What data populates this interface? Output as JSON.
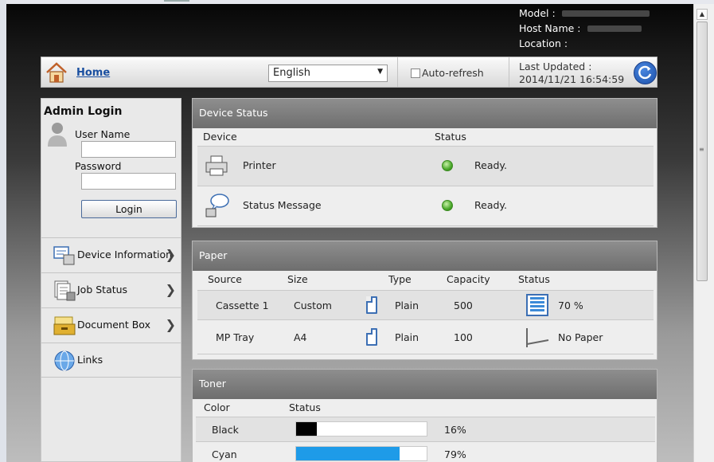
{
  "header": {
    "model_label": "Model :",
    "host_label": "Host Name :",
    "location_label": "Location :"
  },
  "nav": {
    "home": "Home",
    "language": "English",
    "autorefresh": "Auto-refresh",
    "last_updated_label": "Last Updated :",
    "last_updated_value": "2014/11/21 16:54:59"
  },
  "sidebar": {
    "admin_title": "Admin Login",
    "username_label": "User Name",
    "password_label": "Password",
    "login_button": "Login",
    "items": [
      {
        "label": "Device Information",
        "icon": "device-info-icon"
      },
      {
        "label": "Job Status",
        "icon": "job-status-icon"
      },
      {
        "label": "Document Box",
        "icon": "document-box-icon"
      },
      {
        "label": "Links",
        "icon": "globe-icon"
      }
    ]
  },
  "device_status": {
    "title": "Device Status",
    "col_device": "Device",
    "col_status": "Status",
    "rows": [
      {
        "device": "Printer",
        "status": "Ready."
      },
      {
        "device": "Status Message",
        "status": "Ready."
      }
    ]
  },
  "paper": {
    "title": "Paper",
    "col_source": "Source",
    "col_size": "Size",
    "col_type": "Type",
    "col_capacity": "Capacity",
    "col_status": "Status",
    "rows": [
      {
        "source": "Cassette 1",
        "size": "Custom",
        "type": "Plain",
        "capacity": "500",
        "status": "70 %"
      },
      {
        "source": "MP Tray",
        "size": "A4",
        "type": "Plain",
        "capacity": "100",
        "status": "No Paper"
      }
    ]
  },
  "toner": {
    "title": "Toner",
    "col_color": "Color",
    "col_status": "Status",
    "rows": [
      {
        "color": "Black",
        "status": "16%",
        "level": 0.16,
        "fill": "#000000"
      },
      {
        "color": "Cyan",
        "status": "79%",
        "level": 0.79,
        "fill": "#1e9be8"
      }
    ]
  },
  "colors": {
    "link": "#1a4fa0",
    "ready_green": "#4aa82a",
    "panel_header": "#7e7e7e"
  }
}
